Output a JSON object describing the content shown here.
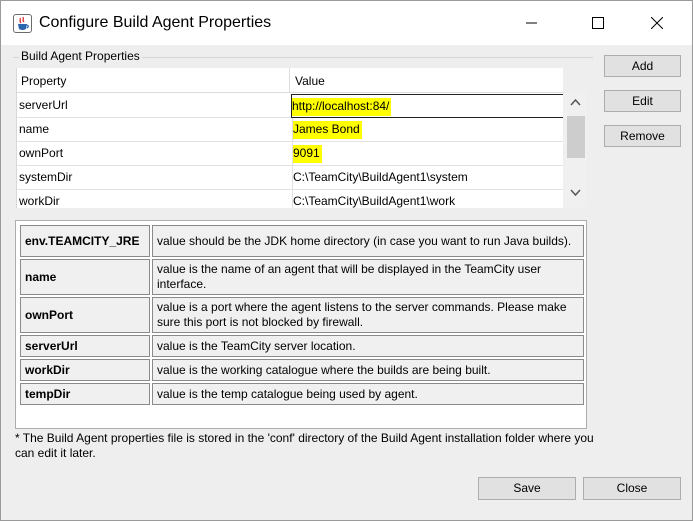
{
  "window": {
    "title": "Configure Build Agent Properties"
  },
  "properties": {
    "group_label": "Build Agent Properties",
    "columns": [
      "Property",
      "Value"
    ],
    "rows": [
      {
        "key": "serverUrl",
        "value": "http://localhost:84/",
        "highlighted": true,
        "editing": true
      },
      {
        "key": "name",
        "value": "James Bond",
        "highlighted": true,
        "editing": false
      },
      {
        "key": "ownPort",
        "value": "9091",
        "highlighted": true,
        "editing": false
      },
      {
        "key": "systemDir",
        "value": "C:\\TeamCity\\BuildAgent1\\system",
        "highlighted": false,
        "editing": false
      },
      {
        "key": "workDir",
        "value": "C:\\TeamCity\\BuildAgent1\\work",
        "highlighted": false,
        "editing": false
      }
    ]
  },
  "side_buttons": {
    "add": "Add",
    "edit": "Edit",
    "remove": "Remove"
  },
  "help": {
    "rows": [
      {
        "term": "env.TEAMCITY_JRE",
        "desc": "value should be the JDK home directory (in case you want to run Java builds)."
      },
      {
        "term": "name",
        "desc": "value is the name of an agent that will be displayed in the TeamCity user interface."
      },
      {
        "term": "ownPort",
        "desc": "value is a port where the agent listens to the server commands. Please make sure this port is not blocked by firewall."
      },
      {
        "term": "serverUrl",
        "desc": "value is the TeamCity server location."
      },
      {
        "term": "workDir",
        "desc": "value is the working catalogue where the builds are being built."
      },
      {
        "term": "tempDir",
        "desc": "value is the temp catalogue being used by agent."
      }
    ]
  },
  "note": "* The Build Agent properties file is stored in the 'conf' directory of the Build Agent installation folder where you can edit it later.",
  "footer": {
    "save": "Save",
    "close": "Close"
  },
  "colors": {
    "highlight": "#ffff00",
    "dialog_bg": "#eeeeee",
    "button_bg": "#e1e1e1"
  }
}
